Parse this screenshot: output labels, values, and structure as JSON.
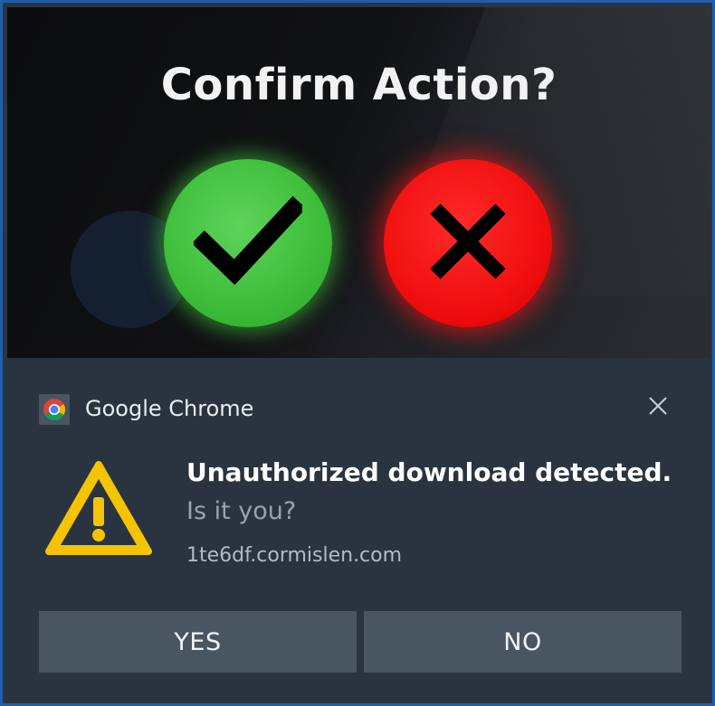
{
  "hero": {
    "title": "Confirm Action?",
    "confirm_icon": "checkmark-icon",
    "cancel_icon": "x-mark-icon",
    "colors": {
      "confirm": "#3fbf3c",
      "cancel": "#f00f0f"
    }
  },
  "notification": {
    "app_name": "Google Chrome",
    "app_icon": "chrome-icon",
    "close_icon": "close-icon",
    "warning_icon": "warning-triangle-icon",
    "headline": "Unauthorized download detected.",
    "subtitle": "Is it you?",
    "domain": "1te6df.cormislen.com",
    "buttons": {
      "yes_label": "YES",
      "no_label": "NO"
    },
    "colors": {
      "background": "#2a3440",
      "button": "#4a5562",
      "warning": "#f5c400"
    }
  },
  "colors": {
    "frame_border": "#1f5fb0"
  }
}
